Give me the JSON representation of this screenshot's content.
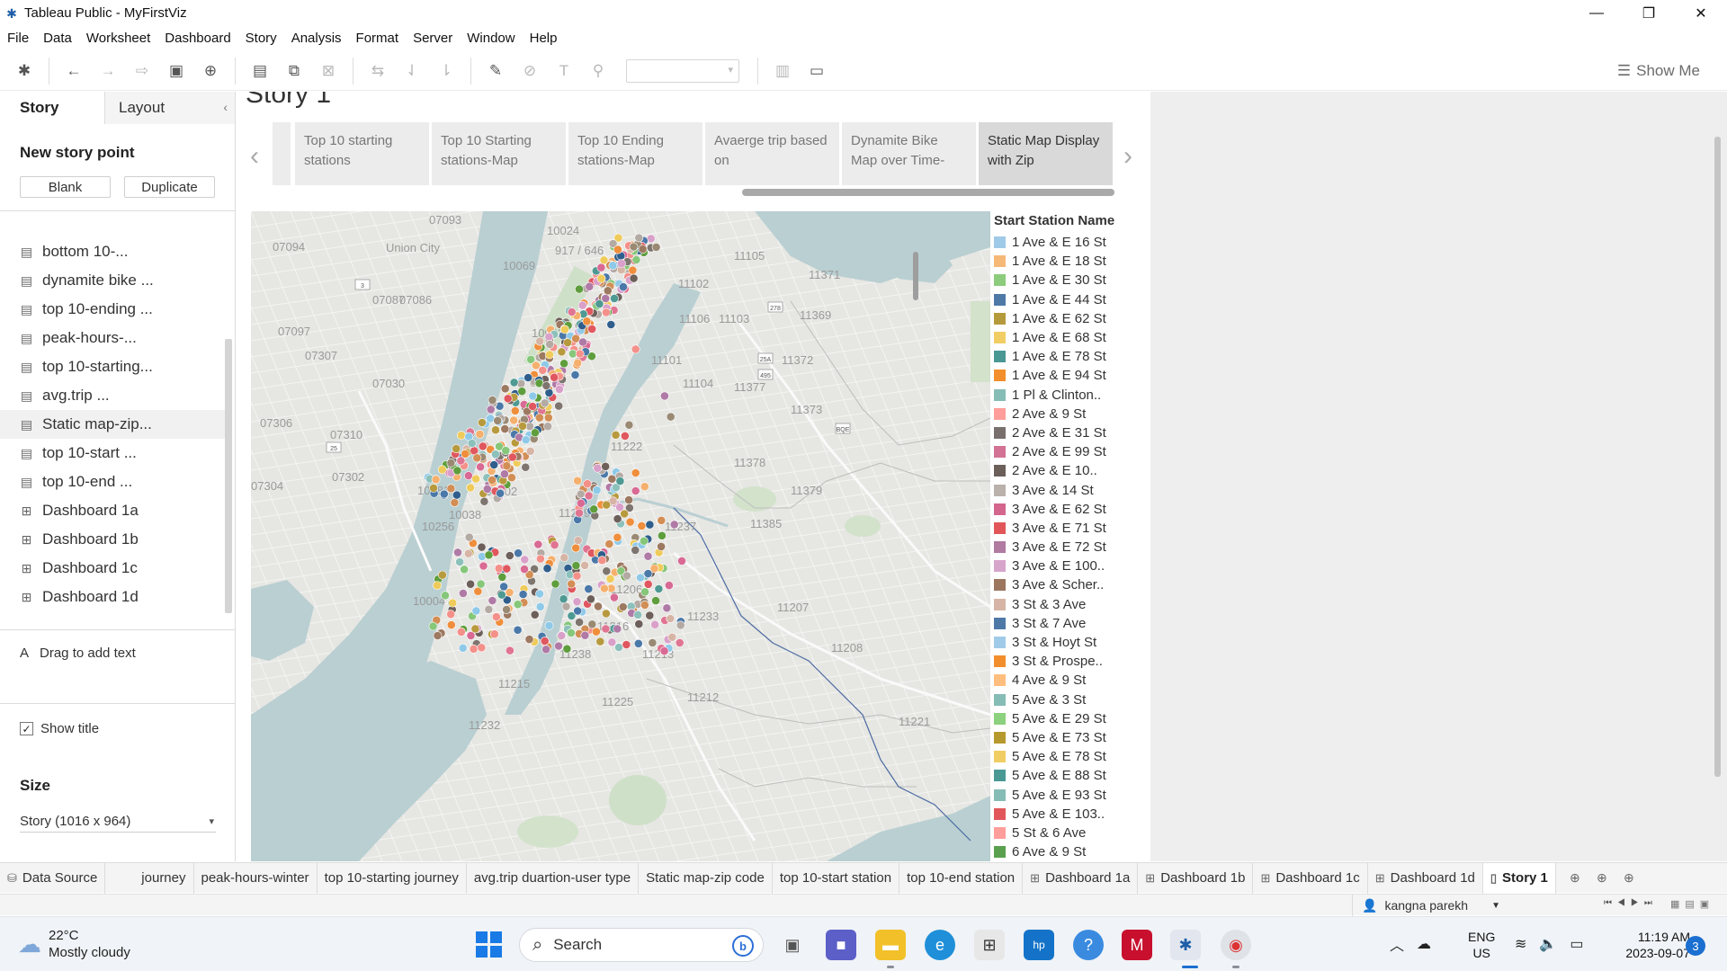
{
  "window": {
    "title": "Tableau Public - MyFirstViz",
    "controls": [
      "—",
      "❐",
      "✕"
    ]
  },
  "menu": [
    "File",
    "Data",
    "Worksheet",
    "Dashboard",
    "Story",
    "Analysis",
    "Format",
    "Server",
    "Window",
    "Help"
  ],
  "toolbar": {
    "show_me": "Show Me"
  },
  "left_panel": {
    "tabs": {
      "story": "Story",
      "layout": "Layout"
    },
    "new_story_point": "New story point",
    "blank_label": "Blank",
    "duplicate_label": "Duplicate",
    "sheets": [
      {
        "label": "bottom 10-...",
        "type": "worksheet"
      },
      {
        "label": "dynamite bike ...",
        "type": "worksheet"
      },
      {
        "label": "top 10-ending ...",
        "type": "worksheet"
      },
      {
        "label": "peak-hours-...",
        "type": "worksheet"
      },
      {
        "label": "top 10-starting...",
        "type": "worksheet"
      },
      {
        "label": "avg.trip ...",
        "type": "worksheet"
      },
      {
        "label": "Static map-zip...",
        "type": "worksheet",
        "active": true
      },
      {
        "label": "top 10-start ...",
        "type": "worksheet"
      },
      {
        "label": "top 10-end ...",
        "type": "worksheet"
      },
      {
        "label": "Dashboard 1a",
        "type": "dashboard"
      },
      {
        "label": "Dashboard 1b",
        "type": "dashboard"
      },
      {
        "label": "Dashboard 1c",
        "type": "dashboard"
      },
      {
        "label": "Dashboard 1d",
        "type": "dashboard"
      }
    ],
    "drag_text": "Drag to add text",
    "show_title": "Show title",
    "size_label": "Size",
    "size_value": "Story (1016 x 964)"
  },
  "story": {
    "title": "Story 1",
    "points": [
      {
        "label": "Top 10 starting stations"
      },
      {
        "label": "Top 10 Starting stations-Map"
      },
      {
        "label": "Top 10 Ending stations-Map"
      },
      {
        "label": "Avaerge trip based on"
      },
      {
        "label": "Dynamite Bike Map over Time-"
      },
      {
        "label": "Static Map Display with Zip",
        "active": true
      }
    ]
  },
  "map": {
    "area_labels": [
      "07093",
      "10024",
      "917 / 646",
      "11105",
      "07094",
      "Union City",
      "10069",
      "11102",
      "11371",
      "07087",
      "07086",
      "11106",
      "11103",
      "11369",
      "07097",
      "10002",
      "11372",
      "07307",
      "11101",
      "11104",
      "11377",
      "07030",
      "11373",
      "07306",
      "07310",
      "11222",
      "11378",
      "07302",
      "11379",
      "07304",
      "10002",
      "11249",
      "11237",
      "11385",
      "10281",
      "10038",
      "10256",
      "11206",
      "10004",
      "11216",
      "11233",
      "11207",
      "11238",
      "11213",
      "11208",
      "11215",
      "11225",
      "11212",
      "11232",
      "11221"
    ],
    "road_shields": [
      "3",
      "25A",
      "495",
      "278",
      "BQE",
      "25"
    ],
    "colors": [
      "#8fc9e8",
      "#f5b06e",
      "#86c77a",
      "#4a78a8",
      "#b89a3e",
      "#efcb5b",
      "#4e9a93",
      "#ef8e3c",
      "#8cc0bb",
      "#f4908a",
      "#7e756f",
      "#e07592",
      "#6d5f5a",
      "#b4aaa4",
      "#d86a94",
      "#e0575f",
      "#b07aa6",
      "#d9a0c9",
      "#9c7960",
      "#d7b5a6",
      "#2f5e8c",
      "#5f9e3d",
      "#9a8a74",
      "#d28e55"
    ]
  },
  "legend": {
    "title": "Start Station Name",
    "items": [
      {
        "label": "1 Ave & E 16 St",
        "color": "#9fcbe8"
      },
      {
        "label": "1 Ave & E 18 St",
        "color": "#f6b877"
      },
      {
        "label": "1 Ave & E 30 St",
        "color": "#8ccc7c"
      },
      {
        "label": "1 Ave & E 44 St",
        "color": "#4e79a7"
      },
      {
        "label": "1 Ave & E 62 St",
        "color": "#b59a3b"
      },
      {
        "label": "1 Ave & E 68 St",
        "color": "#f1ce63"
      },
      {
        "label": "1 Ave & E 78 St",
        "color": "#499894"
      },
      {
        "label": "1 Ave & E 94 St",
        "color": "#f28e2b"
      },
      {
        "label": "1 Pl & Clinton..",
        "color": "#86bcb6"
      },
      {
        "label": "2 Ave & 9 St",
        "color": "#ff9d9a"
      },
      {
        "label": "2 Ave & E 31 St",
        "color": "#79706e"
      },
      {
        "label": "2 Ave & E 99 St",
        "color": "#d37295"
      },
      {
        "label": "2 Ave  & E 10..",
        "color": "#6b5f5a"
      },
      {
        "label": "3 Ave & 14 St",
        "color": "#bab0ac"
      },
      {
        "label": "3 Ave & E 62 St",
        "color": "#d4668e"
      },
      {
        "label": "3 Ave & E 71 St",
        "color": "#e15759"
      },
      {
        "label": "3 Ave & E 72 St",
        "color": "#b07aa1"
      },
      {
        "label": "3 Ave & E 100..",
        "color": "#d7a5cc"
      },
      {
        "label": "3 Ave & Scher..",
        "color": "#9d7660"
      },
      {
        "label": "3 St & 3 Ave",
        "color": "#d7b5a6"
      },
      {
        "label": "3 St & 7 Ave",
        "color": "#4e79a7"
      },
      {
        "label": "3 St & Hoyt St",
        "color": "#a0cbe8"
      },
      {
        "label": "3 St & Prospe..",
        "color": "#f28e2b"
      },
      {
        "label": "4 Ave & 9 St",
        "color": "#ffbe7d"
      },
      {
        "label": "5 Ave & 3 St",
        "color": "#86bcb6"
      },
      {
        "label": "5 Ave & E 29 St",
        "color": "#8cd17d"
      },
      {
        "label": "5 Ave & E 73 St",
        "color": "#b6992d"
      },
      {
        "label": "5 Ave & E 78 St",
        "color": "#f1ce63"
      },
      {
        "label": "5 Ave & E 88 St",
        "color": "#499894"
      },
      {
        "label": "5 Ave & E 93 St",
        "color": "#86bcb6"
      },
      {
        "label": "5 Ave & E 103..",
        "color": "#e15759"
      },
      {
        "label": "5 St & 6 Ave",
        "color": "#ff9d9a"
      },
      {
        "label": "6 Ave & 9 St",
        "color": "#59a14f"
      }
    ]
  },
  "sheet_tabs": [
    {
      "label": "Data Source",
      "icon": "datasource"
    },
    {
      "label": "journey",
      "icon": ""
    },
    {
      "label": "peak-hours-winter",
      "icon": ""
    },
    {
      "label": "top 10-starting journey",
      "icon": ""
    },
    {
      "label": "avg.trip duartion-user type",
      "icon": ""
    },
    {
      "label": "Static map-zip code",
      "icon": ""
    },
    {
      "label": "top 10-start station",
      "icon": ""
    },
    {
      "label": "top 10-end station",
      "icon": ""
    },
    {
      "label": "Dashboard 1a",
      "icon": "dashboard"
    },
    {
      "label": "Dashboard 1b",
      "icon": "dashboard"
    },
    {
      "label": "Dashboard 1c",
      "icon": "dashboard"
    },
    {
      "label": "Dashboard 1d",
      "icon": "dashboard"
    },
    {
      "label": "Story 1",
      "icon": "story",
      "active": true
    }
  ],
  "status": {
    "user": "kangna parekh"
  },
  "taskbar": {
    "weather_temp": "22°C",
    "weather_desc": "Mostly cloudy",
    "search_placeholder": "Search",
    "lang_top": "ENG",
    "lang_bottom": "US",
    "time": "11:19 AM",
    "date": "2023-09-07",
    "notifications": "3"
  }
}
